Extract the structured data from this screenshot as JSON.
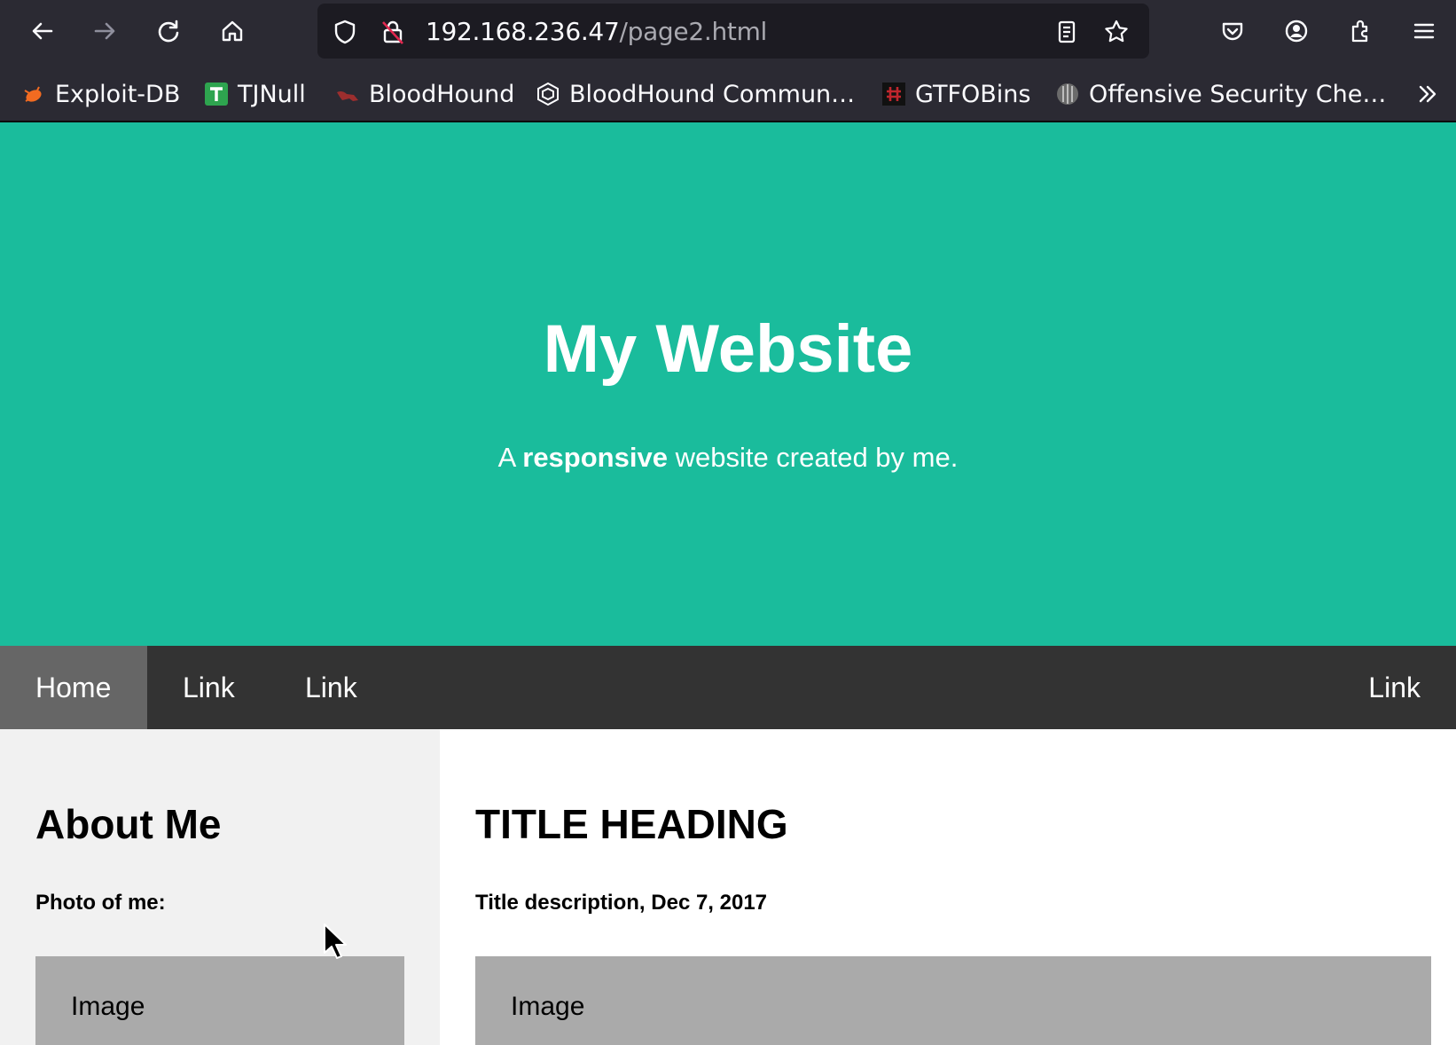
{
  "browser": {
    "url_host": "192.168.236.47",
    "url_path": "/page2.html",
    "bookmarks": [
      {
        "label": "Exploit-DB",
        "icon": "exploit-db-bug-icon"
      },
      {
        "label": "TJNull",
        "icon": "tjnull-icon"
      },
      {
        "label": "BloodHound",
        "icon": "bloodhound-icon"
      },
      {
        "label": "BloodHound Commun…",
        "icon": "bloodhound-community-icon"
      },
      {
        "label": "GTFOBins",
        "icon": "gtfobins-icon"
      },
      {
        "label": "Offensive Security Che…",
        "icon": "offsec-cheatsheet-icon"
      }
    ],
    "colors": {
      "chrome_bg": "#2b2a33",
      "urlbar_bg": "#1c1b22",
      "text": "#fbfbfe"
    }
  },
  "page": {
    "header": {
      "title": "My Website",
      "subtitle_prefix": "A",
      "subtitle_bold": "responsive",
      "subtitle_suffix": "website created by me."
    },
    "navbar": {
      "items": [
        "Home",
        "Link",
        "Link"
      ],
      "right_item": "Link"
    },
    "side": {
      "heading": "About Me",
      "subheading": "Photo of me:",
      "image_label": "Image"
    },
    "main": {
      "heading": "TITLE HEADING",
      "subheading": "Title description, Dec 7, 2017",
      "image_label": "Image"
    },
    "colors": {
      "header_bg": "#1abc9c",
      "navbar_bg": "#333333",
      "nav_active_bg": "#666666",
      "side_bg": "#f1f1f1",
      "fakeimg_bg": "#aaaaaa"
    }
  }
}
